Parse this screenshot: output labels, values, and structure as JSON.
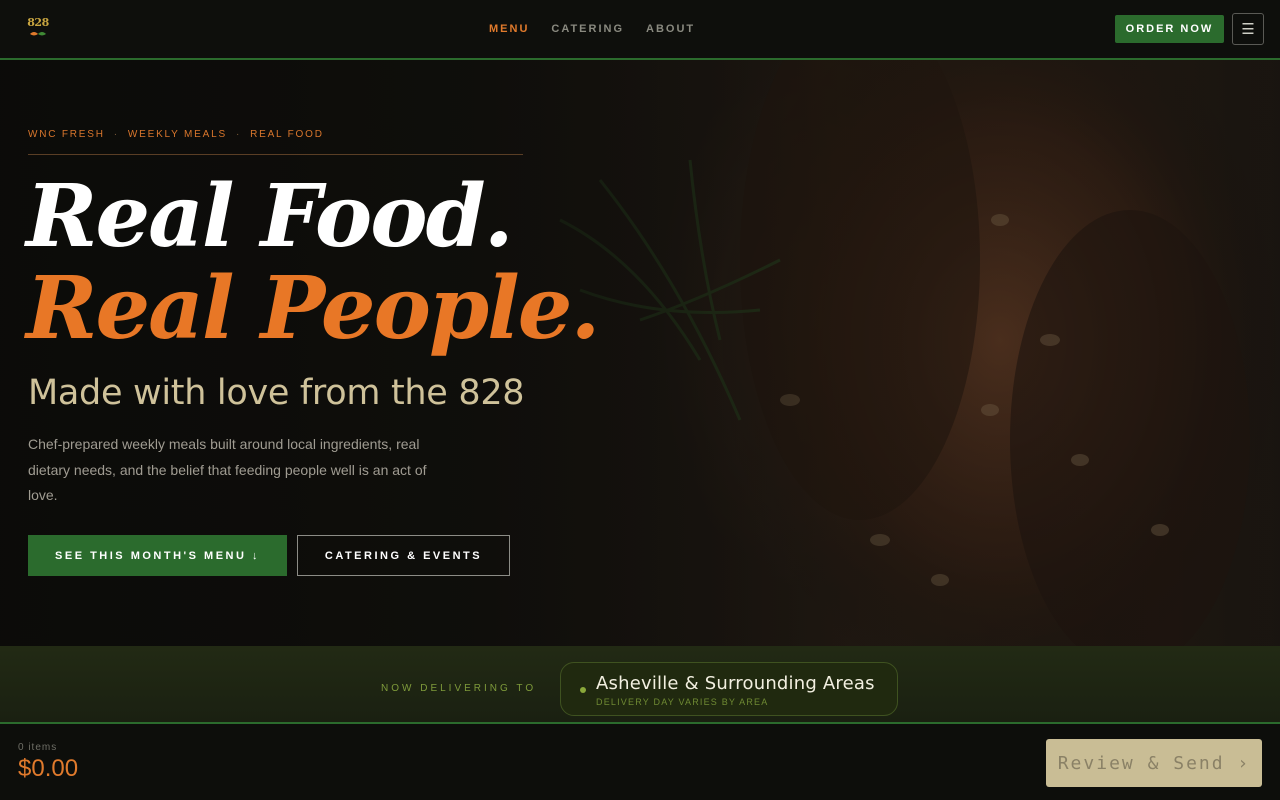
{
  "brand": {
    "logo_text": "828",
    "accent": "#e07a2c",
    "green": "#2b6b2d"
  },
  "nav": {
    "items": [
      {
        "label": "MENU",
        "active": true
      },
      {
        "label": "CATERING",
        "active": false
      },
      {
        "label": "ABOUT",
        "active": false
      }
    ],
    "order_label": "ORDER NOW",
    "menu_icon": "hamburger-icon",
    "menu_glyph": "☰"
  },
  "hero": {
    "eyebrow": [
      "WNC FRESH",
      "WEEKLY MEALS",
      "REAL FOOD"
    ],
    "eyebrow_sep": "·",
    "headline_1": "Real Food.",
    "headline_2": "Real People.",
    "tagline": "Made with love from the 828",
    "description": "Chef-prepared weekly meals built around local ingredients, real dietary needs, and the belief that feeding people well is an act of love.",
    "primary_cta": "SEE THIS MONTH'S MENU ↓",
    "secondary_cta": "CATERING & EVENTS"
  },
  "delivery": {
    "label": "NOW DELIVERING TO",
    "area": "Asheville & Surrounding Areas",
    "note": "DELIVERY DAY VARIES BY AREA"
  },
  "cart": {
    "count": "0 items",
    "total": "$0.00",
    "review_label": "Review & Send ›"
  }
}
